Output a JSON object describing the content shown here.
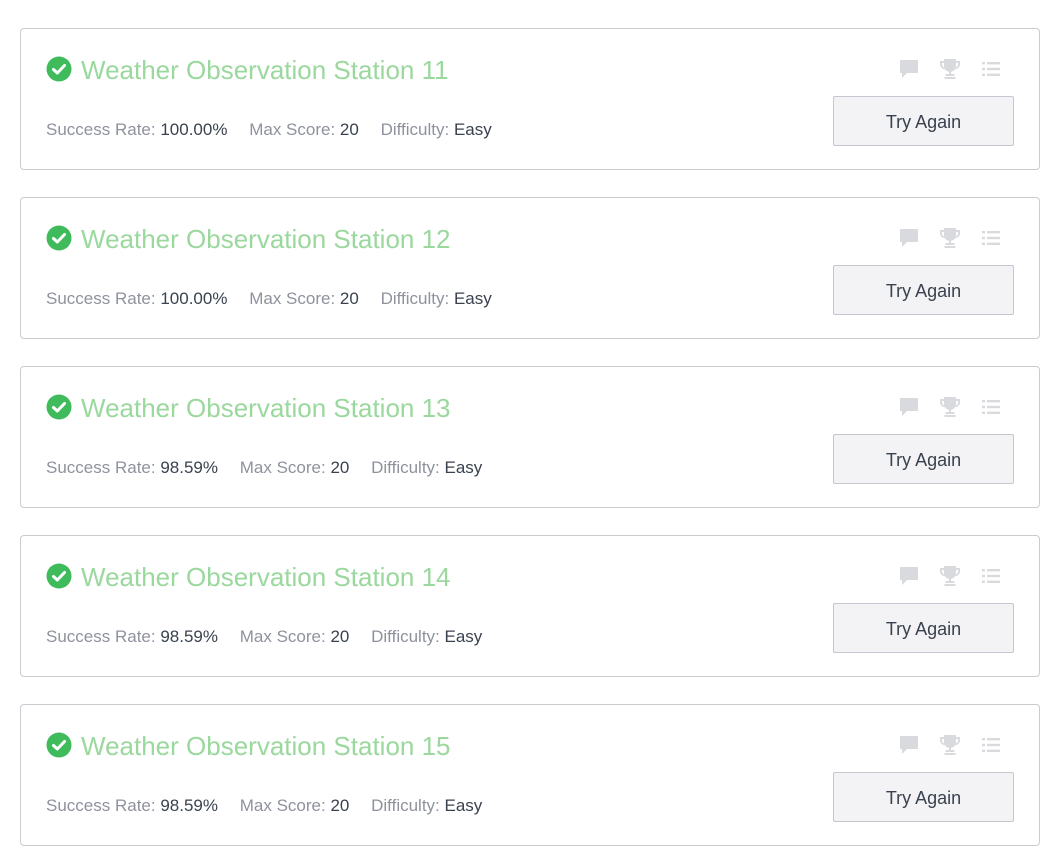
{
  "colors": {
    "title_green": "#9ad89d",
    "check_green": "#3fbb5c",
    "label_gray": "#8e929d",
    "value_dark": "#39424e",
    "icon_gray": "#d8dade",
    "border": "#c9ccd1",
    "button_bg": "#f3f3f5"
  },
  "labels": {
    "success_rate": "Success Rate:",
    "max_score": "Max Score:",
    "difficulty": "Difficulty:"
  },
  "icons": [
    "check-circle-icon",
    "discussion-icon",
    "trophy-icon",
    "list-icon"
  ],
  "challenges": [
    {
      "title": "Weather Observation Station 11",
      "success_rate": "100.00%",
      "max_score": "20",
      "difficulty": "Easy",
      "button": "Try Again"
    },
    {
      "title": "Weather Observation Station 12",
      "success_rate": "100.00%",
      "max_score": "20",
      "difficulty": "Easy",
      "button": "Try Again"
    },
    {
      "title": "Weather Observation Station 13",
      "success_rate": "98.59%",
      "max_score": "20",
      "difficulty": "Easy",
      "button": "Try Again"
    },
    {
      "title": "Weather Observation Station 14",
      "success_rate": "98.59%",
      "max_score": "20",
      "difficulty": "Easy",
      "button": "Try Again"
    },
    {
      "title": "Weather Observation Station 15",
      "success_rate": "98.59%",
      "max_score": "20",
      "difficulty": "Easy",
      "button": "Try Again"
    }
  ]
}
